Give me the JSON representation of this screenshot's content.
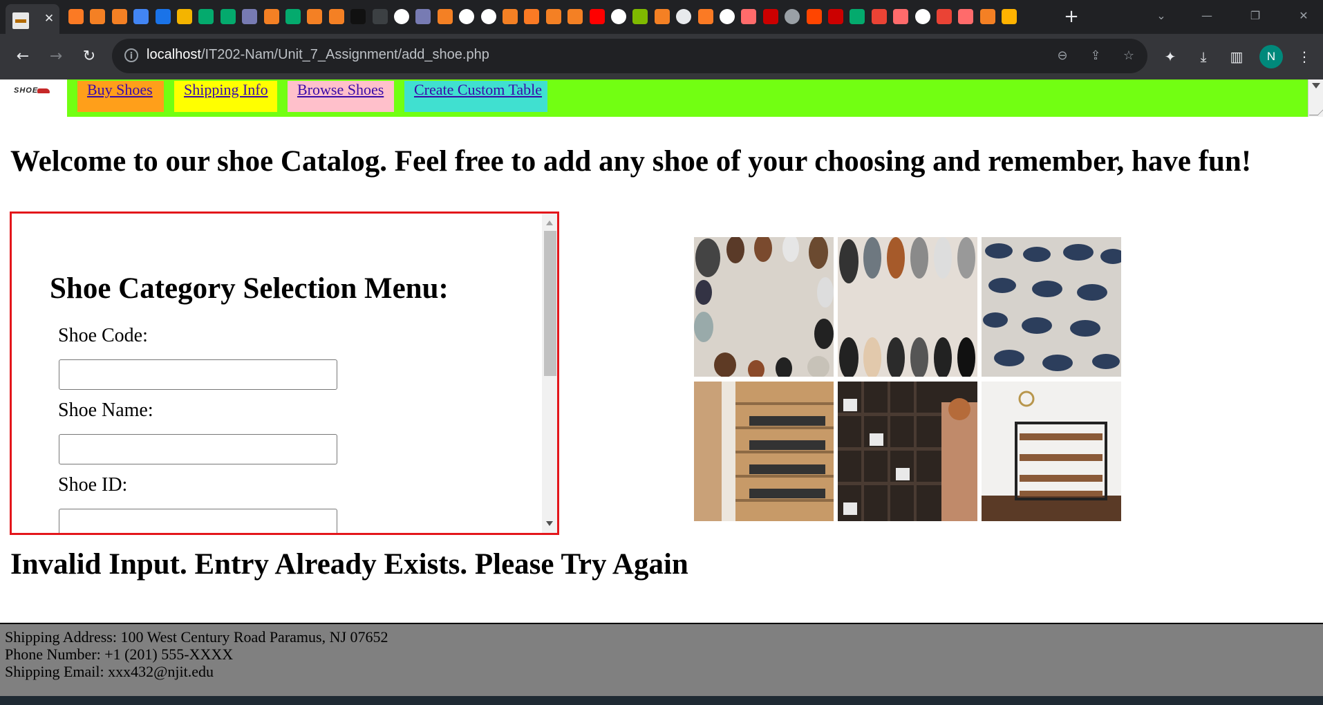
{
  "browser": {
    "active_tab_favicon": "phpmyadmin-icon",
    "tab_icons": [
      "xampp-icon",
      "stackoverflow-icon",
      "stackoverflow-icon",
      "google-docs-icon",
      "circle-c-icon",
      "slides-icon",
      "w3schools-icon",
      "w3schools-icon",
      "php-icon",
      "stackoverflow-icon",
      "w3schools-icon",
      "stackoverflow-icon",
      "stackoverflow-icon",
      "codepen-icon",
      "code-icon",
      "google-icon",
      "php-icon",
      "stackoverflow-icon",
      "google-icon",
      "google-icon",
      "stackoverflow-icon",
      "xampp-icon",
      "stackoverflow-icon",
      "stackoverflow-icon",
      "youtube-icon",
      "google-icon",
      "microsoft-icon",
      "stackoverflow-icon",
      "history-icon",
      "xampp-icon",
      "google-icon",
      "asterisk-icon",
      "njit-icon",
      "globe-icon",
      "reddit-icon",
      "njit-icon",
      "w3schools-icon",
      "g-icon",
      "asterisk-icon",
      "google-icon",
      "g-icon",
      "asterisk-icon",
      "stackoverflow-icon",
      "c-icon"
    ],
    "url_host": "localhost",
    "url_path": "/IT202-Nam/Unit_7_Assignment/add_shoe.php",
    "profile_initial": "N",
    "colors": {
      "tabstrip": "#202124",
      "toolbar": "#35363a",
      "profile": "#00897b"
    }
  },
  "nav": {
    "logo_text": "SHOE",
    "links": [
      {
        "label": "Buy Shoes ",
        "color": "#ff9f1a"
      },
      {
        "label": "Shipping Info ",
        "color": "#ffff00"
      },
      {
        "label": "Browse Shoes ",
        "color": "#ffc0cb"
      },
      {
        "label": "Create Custom Table",
        "color": "#40e0d0"
      }
    ],
    "bar_color": "#72ff12"
  },
  "main": {
    "welcome": "Welcome to our shoe Catalog. Feel free to add any shoe of your choosing and remember, have fun!"
  },
  "form": {
    "title": "Shoe Category Selection Menu:",
    "fields": [
      {
        "label": "Shoe Code:",
        "value": ""
      },
      {
        "label": "Shoe Name:",
        "value": ""
      },
      {
        "label": "Shoe ID:",
        "value": ""
      }
    ],
    "border_color": "#e3161b"
  },
  "gallery": {
    "images": [
      "shoes-circle-floor-image",
      "shoes-row-floor-image",
      "shoes-wall-display-image",
      "closet-shoe-shelves-image",
      "shoe-store-shelves-image",
      "shoe-rack-image"
    ]
  },
  "message": {
    "error": "Invalid Input. Entry Already Exists. Please Try Again"
  },
  "footer": {
    "address": "Shipping Address: 100 West Century Road Paramus, NJ 07652",
    "phone": "Phone Number: +1 (201) 555-XXXX",
    "email": "Shipping Email: xxx432@njit.edu",
    "background": "#808080"
  }
}
